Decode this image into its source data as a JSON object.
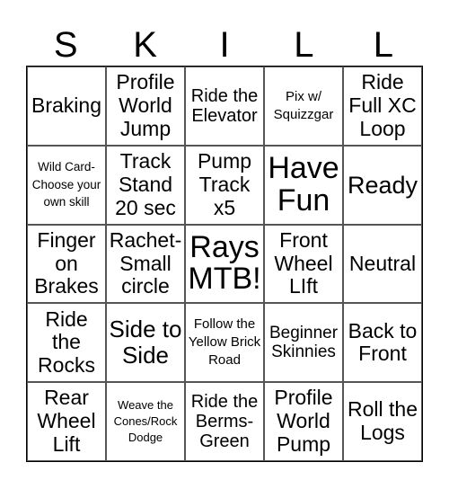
{
  "header": [
    "S",
    "K",
    "I",
    "L",
    "L"
  ],
  "cells": [
    [
      "Braking",
      "Profile World Jump",
      "Ride the Elevator",
      "Pix w/ Squizzgar",
      "Ride Full XC Loop"
    ],
    [
      "Wild Card- Choose your own skill",
      "Track Stand 20 sec",
      "Pump Track x5",
      "Have Fun",
      "Ready"
    ],
    [
      "Finger on Brakes",
      "Rachet- Small circle",
      "Rays MTB!",
      "Front Wheel LIft",
      "Neutral"
    ],
    [
      "Ride the Rocks",
      "Side to Side",
      "Follow the Yellow Brick Road",
      "Beginner Skinnies",
      "Back to Front"
    ],
    [
      "Rear Wheel Lift",
      "Weave the Cones/Rock Dodge",
      "Ride the Berms- Green",
      "Profile World Pump",
      "Roll the Logs"
    ]
  ]
}
